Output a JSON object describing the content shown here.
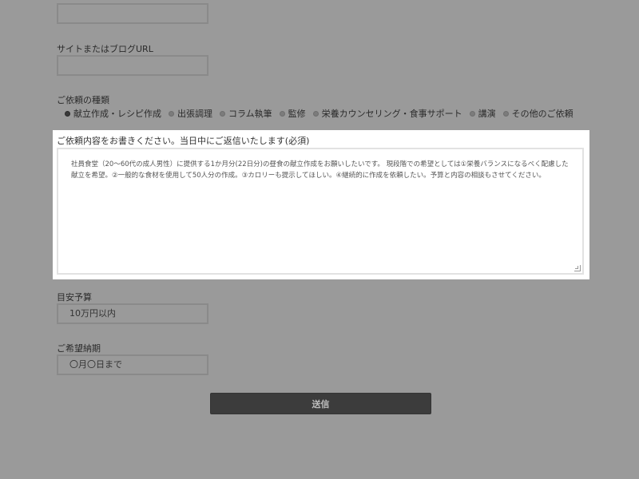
{
  "form": {
    "top_field": {
      "value": ""
    },
    "site_url": {
      "label": "サイトまたはブログURL",
      "value": ""
    },
    "request_type": {
      "label": "ご依頼の種類",
      "options": [
        {
          "label": "献立作成・レシピ作成",
          "checked": true
        },
        {
          "label": "出張調理",
          "checked": false
        },
        {
          "label": "コラム執筆",
          "checked": false
        },
        {
          "label": "監修",
          "checked": false
        },
        {
          "label": "栄養カウンセリング・食事サポート",
          "checked": false
        },
        {
          "label": "講演",
          "checked": false
        },
        {
          "label": "その他のご依頼",
          "checked": false
        }
      ]
    },
    "details": {
      "label": "ご依頼内容をお書きください。当日中にご返信いたします(必須)",
      "value": "社員食堂（20〜60代の成人男性）に提供する1か月分(22日分)の昼食の献立作成をお願いしたいです。 現段階での希望としては①栄養バランスになるべく配慮した献立を希望。②一般的な食材を使用して50人分の作成。③カロリーも提示してほしい。④継続的に作成を依頼したい。予算と内容の相談もさせてください。"
    },
    "budget": {
      "label": "目安予算",
      "value": "10万円以内"
    },
    "deadline": {
      "label": "ご希望納期",
      "value": "〇月〇日まで"
    },
    "submit_label": "送信"
  }
}
